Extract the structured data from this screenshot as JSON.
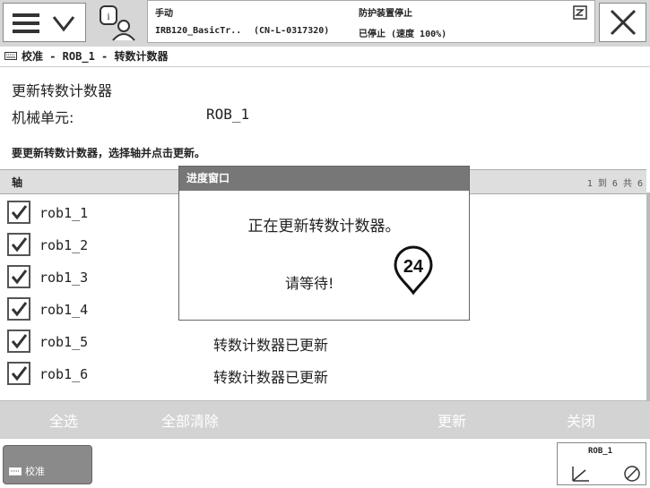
{
  "topbar": {
    "mode": "手动",
    "system_name": "IRB120_BasicTr..",
    "serial": "(CN-L-0317320)",
    "status_line1": "防护装置停止",
    "status_line2": "已停止 (速度 100%)"
  },
  "title_bar": {
    "text": "校准 - ROB_1 - 转数计数器"
  },
  "content": {
    "heading": "更新转数计数器",
    "mech_unit_label": "机械单元:",
    "mech_unit_value": "ROB_1",
    "instruction": "要更新转数计数器，选择轴并点击更新。"
  },
  "table": {
    "column_axis": "轴",
    "count": "1 到 6 共 6",
    "rows": [
      {
        "axis": "rob1_1",
        "checked": true,
        "status": ""
      },
      {
        "axis": "rob1_2",
        "checked": true,
        "status": ""
      },
      {
        "axis": "rob1_3",
        "checked": true,
        "status": ""
      },
      {
        "axis": "rob1_4",
        "checked": true,
        "status": ""
      },
      {
        "axis": "rob1_5",
        "checked": true,
        "status": "转数计数器已更新"
      },
      {
        "axis": "rob1_6",
        "checked": true,
        "status": "转数计数器已更新"
      }
    ]
  },
  "actions": {
    "select_all": "全选",
    "clear_all": "全部清除",
    "update": "更新",
    "close": "关闭"
  },
  "taskbar": {
    "tab_label": "校准",
    "jog_unit": "ROB_1"
  },
  "dialog": {
    "title": "进度窗口",
    "message": "正在更新转数计数器。",
    "wait": "请等待!"
  },
  "badge": {
    "number": "24"
  },
  "icons": {
    "menu": "menu-icon",
    "chevron": "chevron-down-icon",
    "info": "info-user-icon",
    "close": "close-icon",
    "checkbox": "check-icon",
    "keyboard": "keyboard-icon",
    "jog": "jog-axes-icon"
  },
  "colors": {
    "topbar_bg": "#d6d6d6",
    "dialog_title_bg": "#777777",
    "actionbar_bg": "#d3d3d3",
    "taskbar_tab_bg": "#8a8a8a"
  }
}
